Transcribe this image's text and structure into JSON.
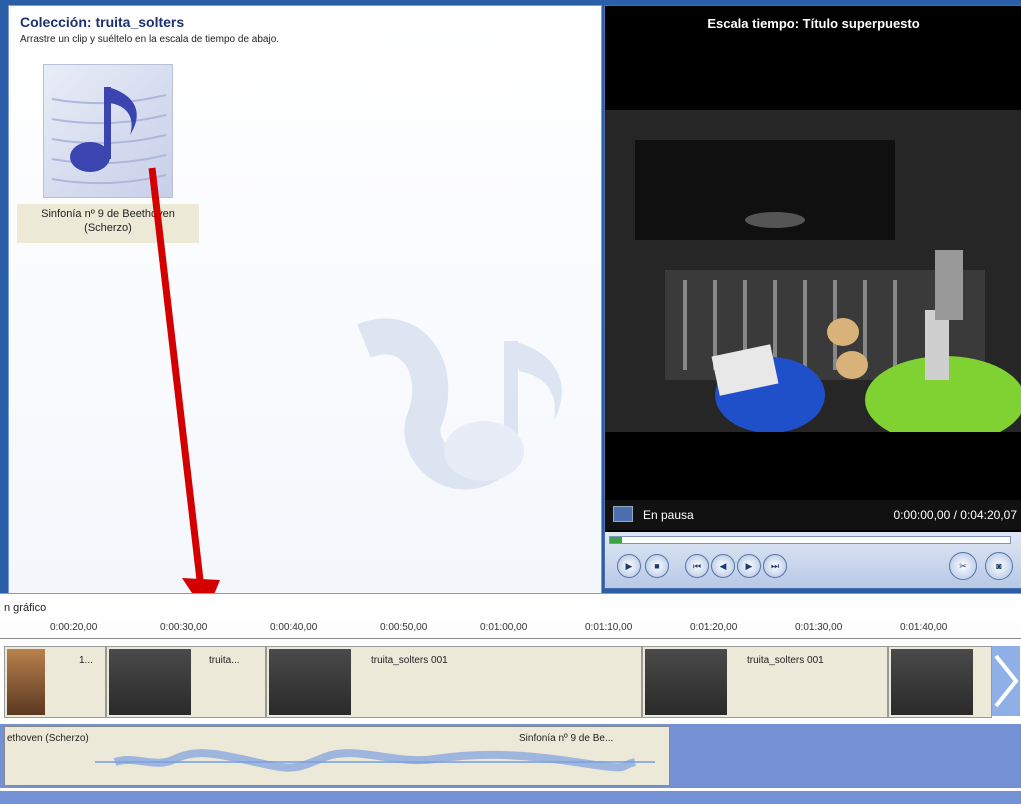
{
  "collection": {
    "title": "Colección: truita_solters",
    "hint": "Arrastre un clip y suéltelo en la escala de tiempo de abajo.",
    "clip": {
      "caption": "Sinfonía nº 9 de Beethoven (Scherzo)",
      "icon": "music-note-icon"
    }
  },
  "preview": {
    "title": "Escala tiempo: Título superpuesto",
    "status": "En pausa",
    "time": "0:00:00,00 / 0:04:20,07"
  },
  "storyboard": {
    "label": "n gráfico",
    "ruler": [
      "0:00:20,00",
      "0:00:30,00",
      "0:00:40,00",
      "0:00:50,00",
      "0:01:00,00",
      "0:01:10,00",
      "0:01:20,00",
      "0:01:30,00",
      "0:01:40,00"
    ],
    "video_clips": [
      {
        "name": "1..."
      },
      {
        "name": "truita..."
      },
      {
        "name": "truita_solters 001"
      },
      {
        "name": "truita_solters 001"
      }
    ],
    "audio_clip": {
      "name_left": "ethoven (Scherzo)",
      "name_right": "Sinfonía nº 9 de Be..."
    }
  },
  "colors": {
    "arrow": "#d40000"
  }
}
